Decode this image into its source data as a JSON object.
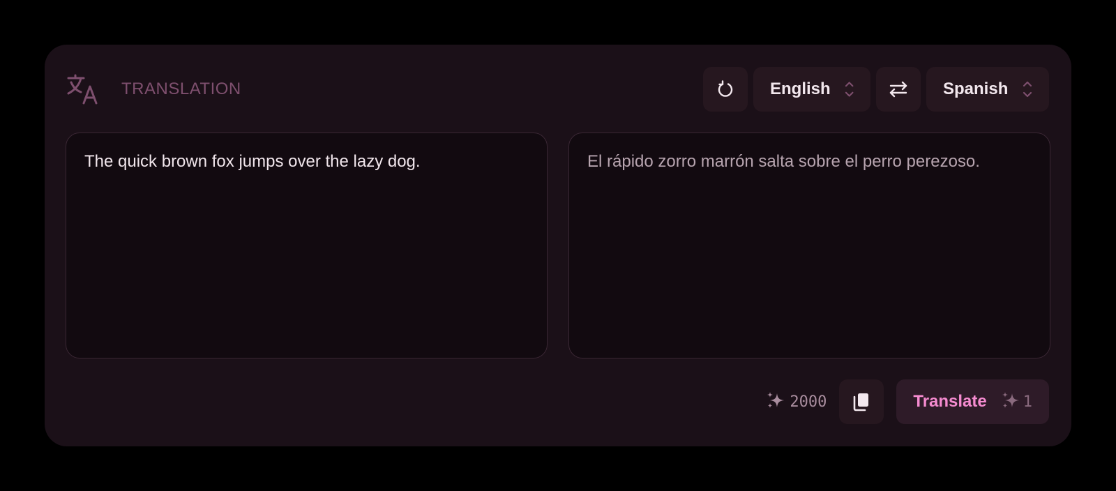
{
  "header": {
    "title": "TRANSLATION",
    "icon": "translate-icon"
  },
  "controls": {
    "reset_icon": "refresh-icon",
    "source_language": "English",
    "swap_icon": "swap-arrows-icon",
    "target_language": "Spanish"
  },
  "source": {
    "text": "The quick brown fox jumps over the lazy dog."
  },
  "target": {
    "text": "El rápido zorro marrón salta sobre el perro perezoso."
  },
  "footer": {
    "credits_remaining": "2000",
    "copy_icon": "copy-icon",
    "translate_label": "Translate",
    "translate_cost": "1"
  },
  "colors": {
    "accent": "#f58bd0",
    "card_bg": "#1b1018",
    "panel_bg": "#120a10",
    "muted_title": "#7e4f6e"
  }
}
